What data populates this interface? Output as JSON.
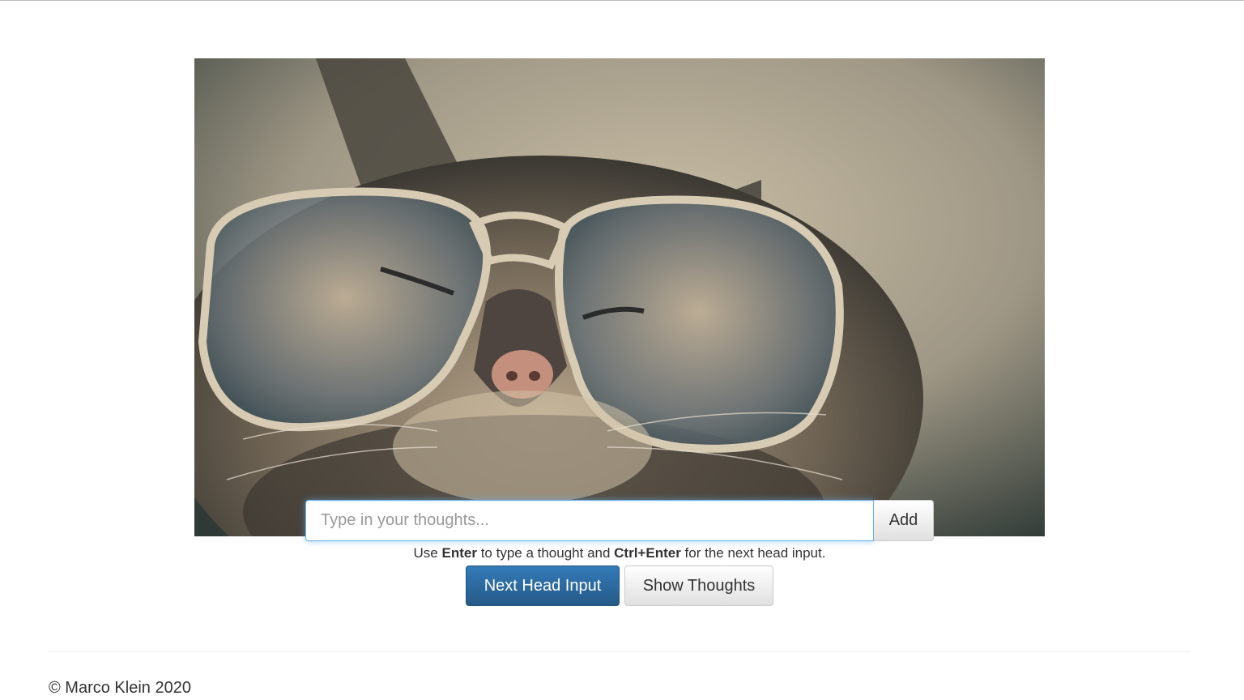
{
  "image": {
    "alt_icon": "cat-with-glasses-photo"
  },
  "thought_input": {
    "placeholder": "Type in your thoughts...",
    "value": ""
  },
  "add_button": {
    "label": "Add"
  },
  "hint": {
    "part1": "Use ",
    "key1": "Enter",
    "part2": " to type a thought and ",
    "key2": "Ctrl+Enter",
    "part3": " for the next head input."
  },
  "buttons": {
    "next_head_input": "Next Head Input",
    "show_thoughts": "Show Thoughts"
  },
  "footer": {
    "copyright": "© Marco Klein 2020"
  },
  "colors": {
    "primary": "#337ab7",
    "focus_border": "#66afe9"
  }
}
